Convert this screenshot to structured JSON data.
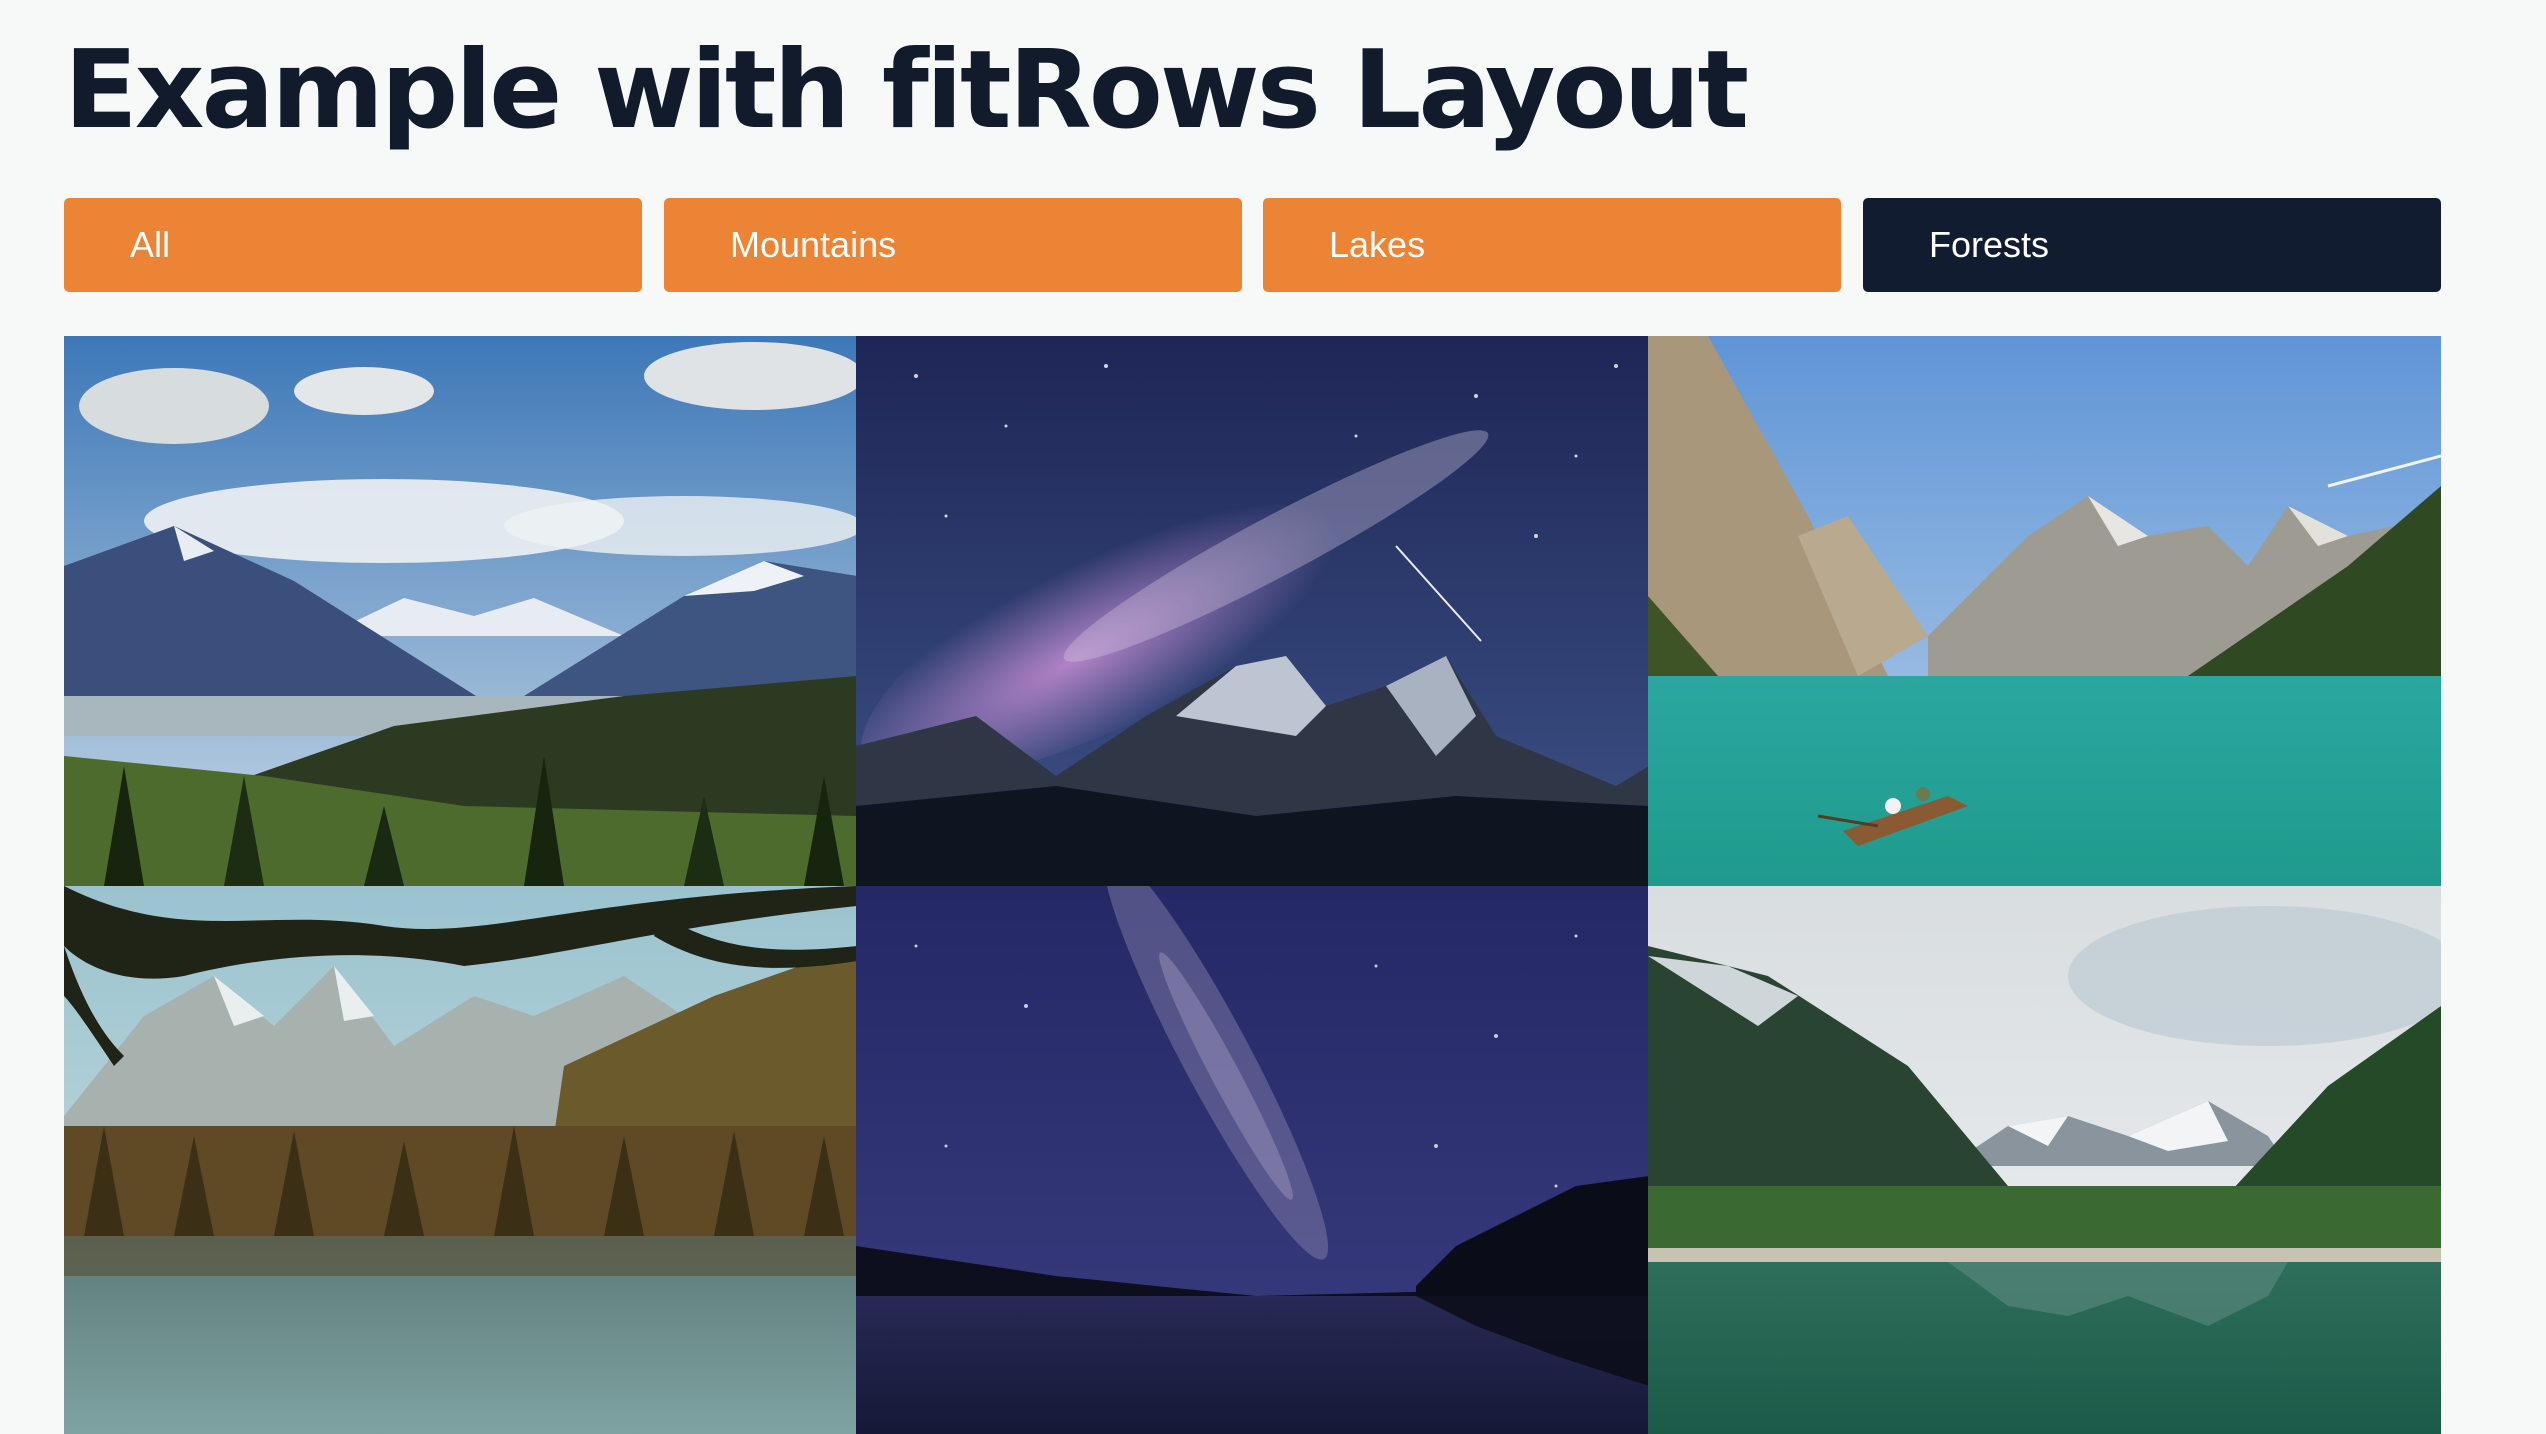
{
  "page": {
    "title": "Example with fitRows Layout"
  },
  "filters": [
    {
      "label": "All",
      "active": false
    },
    {
      "label": "Mountains",
      "active": false
    },
    {
      "label": "Lakes",
      "active": false
    },
    {
      "label": "Forests",
      "active": true
    }
  ],
  "colors": {
    "filter_inactive": "#ec8436",
    "filter_active": "#111c30",
    "title": "#111b2c",
    "background": "#f7f9f9"
  },
  "gallery": {
    "images": [
      {
        "subject": "snowy mountain valley with pine forest under cloudy sky"
      },
      {
        "subject": "milky way over snowy mountain peaks at night"
      },
      {
        "subject": "turquoise alpine lake with rowboat below rocky cliffs"
      },
      {
        "subject": "forest lake with mountains framed by tree branches"
      },
      {
        "subject": "milky way over dark lake with forest silhouette"
      },
      {
        "subject": "green alpine lake reflecting snowy mountains"
      }
    ]
  }
}
